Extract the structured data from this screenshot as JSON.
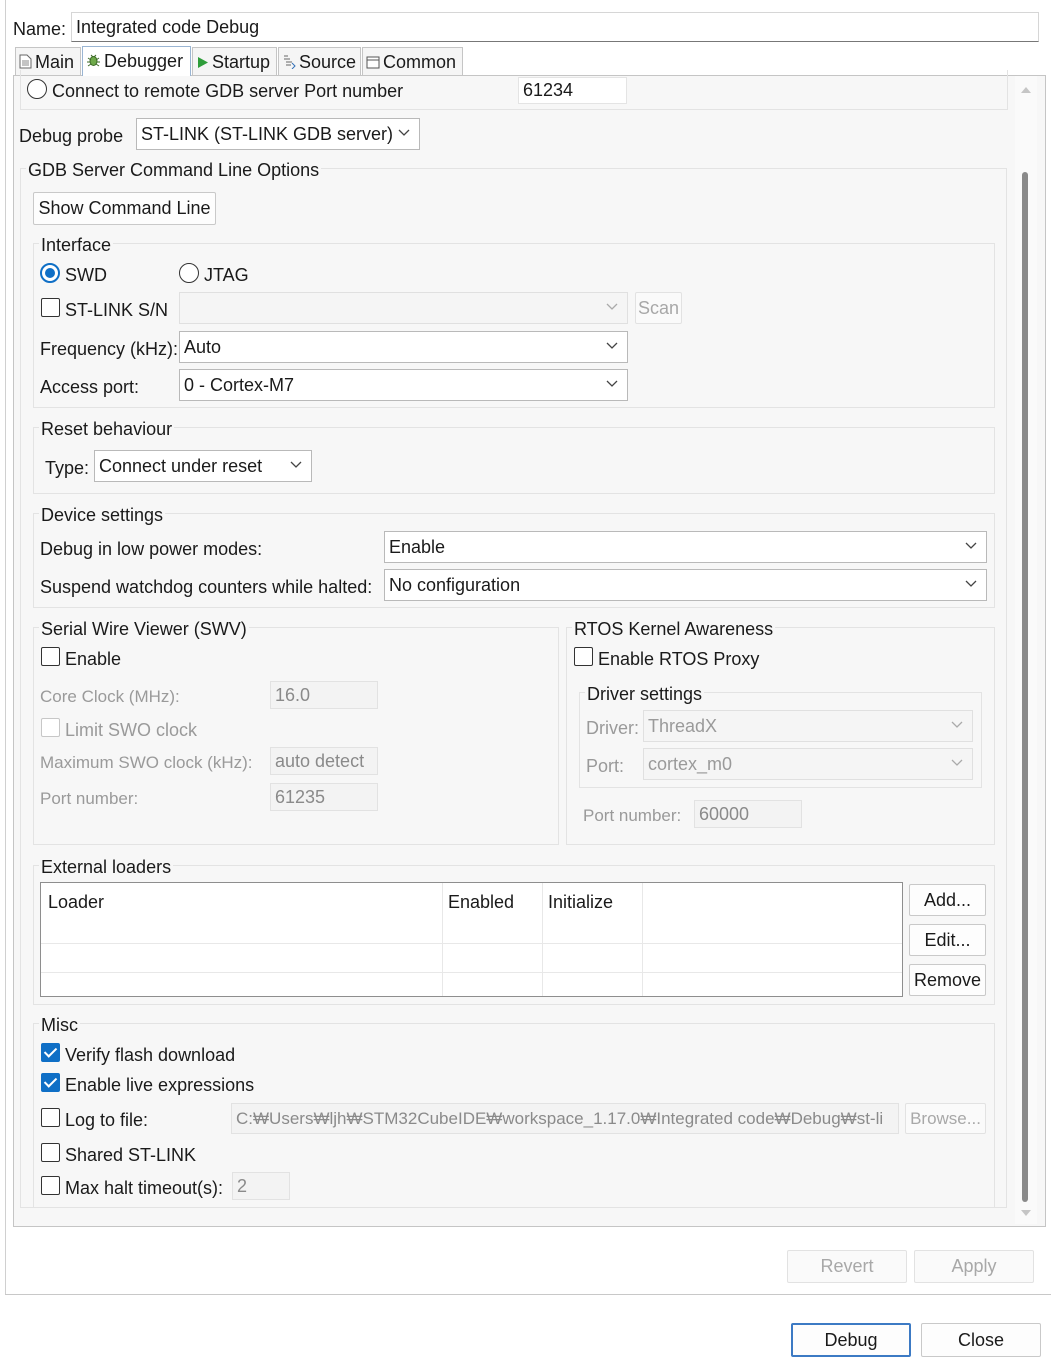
{
  "name_label": "Name:",
  "name_value": "Integrated code Debug",
  "tabs": [
    {
      "label": "Main",
      "icon": "document-icon"
    },
    {
      "label": "Debugger",
      "icon": "debug-bug-icon"
    },
    {
      "label": "Startup",
      "icon": "play-icon"
    },
    {
      "label": "Source",
      "icon": "source-icon"
    },
    {
      "label": "Common",
      "icon": "window-icon"
    }
  ],
  "active_tab": "Debugger",
  "remote": {
    "label": "Connect to remote GDB server Port number",
    "port": "61234"
  },
  "probe": {
    "label": "Debug probe",
    "value": "ST-LINK (ST-LINK GDB server)"
  },
  "gdb_group": {
    "title": "GDB Server Command Line Options",
    "show_cmd_button": "Show Command Line"
  },
  "interface": {
    "title": "Interface",
    "swd": "SWD",
    "jtag": "JTAG",
    "selected": "SWD",
    "stlink_sn_label": "ST-LINK S/N",
    "stlink_sn_value": "",
    "scan_button": "Scan",
    "frequency_label": "Frequency (kHz):",
    "frequency_value": "Auto",
    "access_port_label": "Access port:",
    "access_port_value": "0 - Cortex-M7"
  },
  "reset": {
    "title": "Reset behaviour",
    "type_label": "Type:",
    "type_value": "Connect under reset"
  },
  "device": {
    "title": "Device settings",
    "low_power_label": "Debug in low power modes:",
    "low_power_value": "Enable",
    "watchdog_label": "Suspend watchdog counters while halted:",
    "watchdog_value": "No configuration"
  },
  "swv": {
    "title": "Serial Wire Viewer (SWV)",
    "enable_label": "Enable",
    "enabled": false,
    "core_clock_label": "Core Clock (MHz):",
    "core_clock_value": "16.0",
    "limit_swo_label": "Limit SWO clock",
    "max_swo_label": "Maximum SWO clock (kHz):",
    "max_swo_value": "auto detect",
    "port_label": "Port number:",
    "port_value": "61235"
  },
  "rtos": {
    "title": "RTOS Kernel Awareness",
    "enable_label": "Enable RTOS Proxy",
    "enabled": false,
    "driver_group_title": "Driver settings",
    "driver_label": "Driver:",
    "driver_value": "ThreadX",
    "port_label": "Port:",
    "port_value": "cortex_m0",
    "port_number_label": "Port number:",
    "port_number_value": "60000"
  },
  "loaders": {
    "title": "External loaders",
    "columns": [
      "Loader",
      "Enabled",
      "Initialize"
    ],
    "rows": [],
    "add_button": "Add...",
    "edit_button": "Edit...",
    "remove_button": "Remove"
  },
  "misc": {
    "title": "Misc",
    "verify_flash_label": "Verify flash download",
    "verify_flash": true,
    "live_expr_label": "Enable live expressions",
    "live_expr": true,
    "log_label": "Log to file:",
    "log_enabled": false,
    "log_path": "C:₩Users₩ljh₩STM32CubeIDE₩workspace_1.17.0₩Integrated code₩Debug₩st-li",
    "browse_button": "Browse...",
    "shared_label": "Shared ST-LINK",
    "shared": false,
    "max_halt_label": "Max halt timeout(s):",
    "max_halt_enabled": false,
    "max_halt_value": "2"
  },
  "footer": {
    "revert": "Revert",
    "apply": "Apply",
    "debug": "Debug",
    "close": "Close"
  },
  "colors": {
    "accent": "#0f6fc6",
    "panel_bg": "#f7f7f7",
    "disabled_text": "#9a9a9a"
  }
}
